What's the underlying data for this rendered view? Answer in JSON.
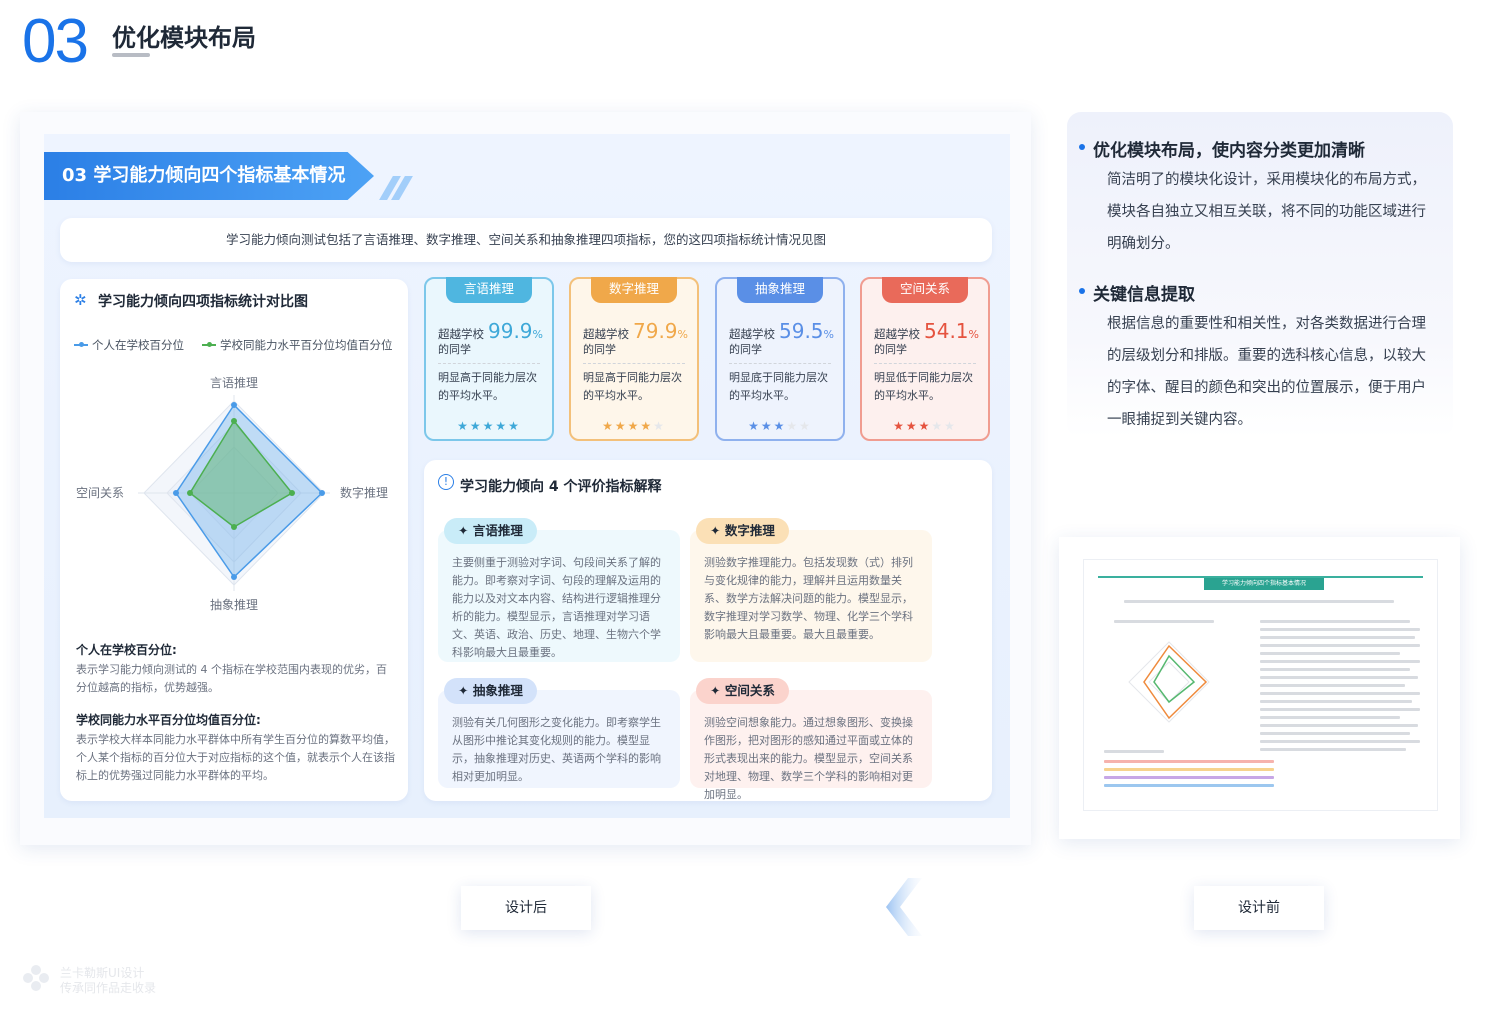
{
  "section": {
    "number": "03",
    "title": "优化模块布局"
  },
  "after": {
    "banner": "03 学习能力倾向四个指标基本情况",
    "intro": "学习能力倾向测试包括了言语推理、数字推理、空间关系和抽象推理四项指标，您的这四项指标统计情况见图",
    "radar": {
      "title": "学习能力倾向四项指标统计对比图",
      "legend": [
        "个人在学校百分位",
        "学校同能力水平百分位均值百分位"
      ],
      "axes": [
        "言语推理",
        "数字推理",
        "抽象推理",
        "空间关系"
      ],
      "colors": {
        "personal": "#4a9be8",
        "school": "#4caf50"
      },
      "desc1_h": "个人在学校百分位:",
      "desc1_p": "表示学习能力倾向测试的 4 个指标在学校范围内表现的优劣，百分位越高的指标，优势越强。",
      "desc2_h": "学校同能力水平百分位均值百分位:",
      "desc2_p": "表示学校大样本同能力水平群体中所有学生百分位的算数平均值，个人某个指标的百分位大于对应指标的这个值，就表示个人在该指标上的优势强过同能力水平群体的平均。"
    },
    "stats": [
      {
        "tag": "言语推理",
        "school": "超越学校",
        "value": "99.9",
        "unit": "%",
        "sub": "的同学",
        "desc": "明显高于同能力层次的平均水平。",
        "stars": 5,
        "color": "#4fb6e0",
        "bg": "#eaf7fd",
        "accent": "#3ea8d8"
      },
      {
        "tag": "数字推理",
        "school": "超越学校",
        "value": "79.9",
        "unit": "%",
        "sub": "的同学",
        "desc": "明显高于同能力层次的平均水平。",
        "stars": 4,
        "color": "#f0a84a",
        "bg": "#fef6ea",
        "accent": "#f0a84a"
      },
      {
        "tag": "抽象推理",
        "school": "超越学校",
        "value": "59.5",
        "unit": "%",
        "sub": "的同学",
        "desc": "明显底于同能力层次的平均水平。",
        "stars": 3,
        "color": "#5a8fe6",
        "bg": "#eef3fd",
        "accent": "#5a8fe6"
      },
      {
        "tag": "空间关系",
        "school": "超越学校",
        "value": "54.1",
        "unit": "%",
        "sub": "的同学",
        "desc": "明显低于同能力层次的平均水平。",
        "stars": 3,
        "color": "#e96a5a",
        "bg": "#fdf0ee",
        "accent": "#e5533f"
      }
    ],
    "explain": {
      "title": "学习能力倾向 4 个评价指标解释",
      "items": [
        {
          "tag": "言语推理",
          "text": "主要侧重于测验对字词、句段间关系了解的能力。即考察对字词、句段的理解及运用的能力以及对文本内容、结构进行逻辑推理分析的能力。模型显示，言语推理对学习语文、英语、政治、历史、地理、生物六个学科影响最大且最重要。",
          "tagbg": "#c9ecf8",
          "bg": "#eef9fd"
        },
        {
          "tag": "数字推理",
          "text": "测验数字推理能力。包括发现数（式）排列与变化规律的能力，理解并且运用数量关系、数学方法解决问题的能力。模型显示，数字推理对学习数学、物理、化学三个学科影响最大且最重要。最大且最重要。",
          "tagbg": "#fbe0b6",
          "bg": "#fef7ec"
        },
        {
          "tag": "抽象推理",
          "text": "测验有关几何图形之变化能力。即考察学生从图形中推论其变化规则的能力。模型显示，抽象推理对历史、英语两个学科的影响相对更加明显。",
          "tagbg": "#d3e2fa",
          "bg": "#f0f5fe"
        },
        {
          "tag": "空间关系",
          "text": "测验空间想象能力。通过想象图形、变换操作图形，把对图形的感知通过平面或立体的形式表现出来的能力。模型显示，空间关系对地理、物理、数学三个学科的影响相对更加明显。",
          "tagbg": "#fbd3cc",
          "bg": "#fef1ef"
        }
      ]
    }
  },
  "bullets": [
    {
      "head": "优化模块布局，使内容分类更加清晰",
      "text": "简洁明了的模块化设计，采用模块化的布局方式，模块各自独立又相互关联，将不同的功能区域进行明确划分。"
    },
    {
      "head": "关键信息提取",
      "text": "根据信息的重要性和相关性，对各类数据进行合理的层级划分和排版。重要的选科核心信息，以较大的字体、醒目的颜色和突出的位置展示，便于用户一眼捕捉到关键内容。"
    }
  ],
  "before": {
    "title": "学习能力倾向四个指标基本情况"
  },
  "labels": {
    "after": "设计后",
    "before": "设计前"
  },
  "watermark": {
    "line1": "兰卡勒斯UI设计",
    "line2": "传承同作品走收录"
  }
}
